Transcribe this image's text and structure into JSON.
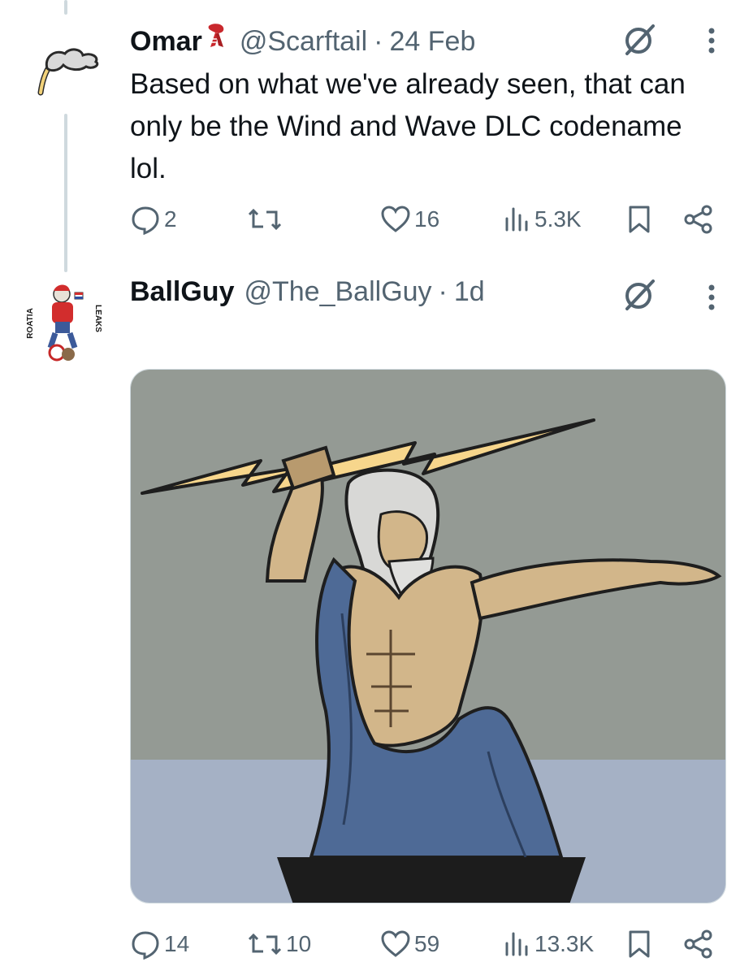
{
  "tweets": [
    {
      "author_name": "Omar",
      "author_emoji": "scarf-emoji",
      "handle": "@Scarftail",
      "separator": "·",
      "time": "24 Feb",
      "text": "Based on what we've already seen, that can only be the Wind and Wave DLC codename lol.",
      "replies": "2",
      "reposts": "",
      "likes": "16",
      "views": "5.3K"
    },
    {
      "author_name": "BallGuy",
      "handle": "@The_BallGuy",
      "separator": "·",
      "time": "1d",
      "avatar_text_left": "ROATIA",
      "avatar_text_right": "LEAKS",
      "media_description": "zeus-lightning-illustration",
      "replies": "14",
      "reposts": "10",
      "likes": "59",
      "views": "13.3K"
    }
  ],
  "icons": [
    "reply-icon",
    "repost-icon",
    "like-icon",
    "views-icon",
    "bookmark-icon",
    "share-icon",
    "grok-icon",
    "more-icon"
  ],
  "colors": {
    "text": "#0f1419",
    "secondary": "#536471",
    "thread_line": "#cfd9de",
    "sky": "#949a94",
    "sea": "#a5b1c5",
    "bolt": "#f7d68c",
    "skin": "#d2b68a",
    "robe": "#4e6a96"
  }
}
